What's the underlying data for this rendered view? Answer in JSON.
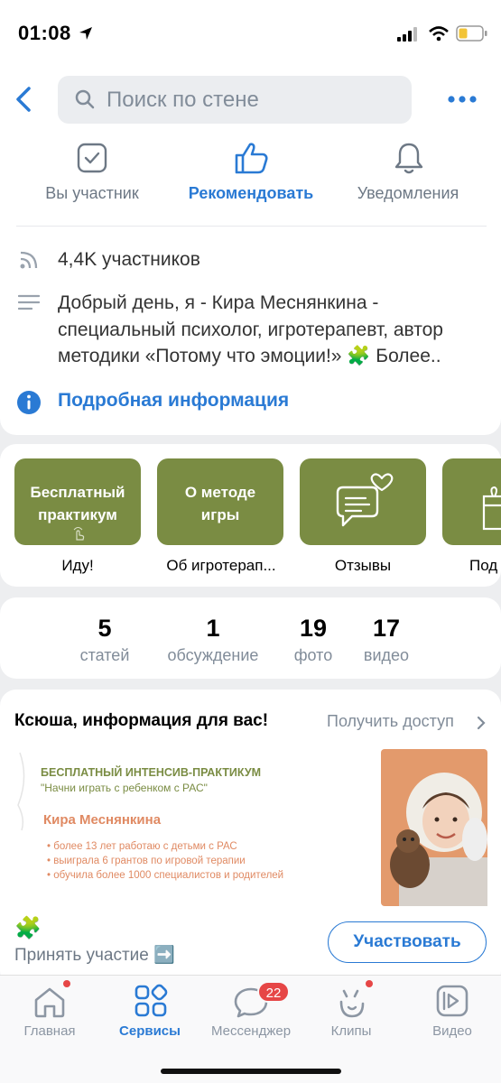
{
  "status_bar": {
    "time": "01:08"
  },
  "header": {
    "search_placeholder": "Поиск по стене"
  },
  "actions": [
    {
      "label": "Вы участник",
      "icon": "checkbox-icon"
    },
    {
      "label": "Рекомендовать",
      "icon": "thumbs-up-icon"
    },
    {
      "label": "Уведомления",
      "icon": "bell-icon"
    }
  ],
  "info": {
    "members": "4,4K участников",
    "description_lines": [
      "Добрый день, я - Кира Меснянкина -",
      "специальный психолог, игротерапевт, автор",
      "методики «Потому что эмоции!» 🧩 Более.."
    ],
    "more_info": "Подробная информация"
  },
  "tiles": [
    {
      "title_lines": [
        "Бесплатный",
        "практикум"
      ],
      "caption": "Иду!"
    },
    {
      "title_lines": [
        "О методе",
        "игры"
      ],
      "caption": "Об игротерап..."
    },
    {
      "caption": "Отзывы",
      "icon": "message-heart-icon"
    },
    {
      "caption": "Под",
      "icon": "gift-icon"
    }
  ],
  "stats": [
    {
      "value": "5",
      "label": "статей"
    },
    {
      "value": "1",
      "label": "обсуждение"
    },
    {
      "value": "19",
      "label": "фото"
    },
    {
      "value": "17",
      "label": "видео"
    }
  ],
  "promo": {
    "title": "Ксюша, информация для вас!",
    "link": "Получить доступ",
    "banner": {
      "heading": "БЕСПЛАТНЫЙ ИНТЕНСИВ-ПРАКТИКУМ",
      "subheading": "\"Начни играть с ребенком с РАС\"",
      "name": "Кира Меснянкина",
      "bullets": [
        "более 13 лет работаю с детьми с РАС",
        "выиграла 6 грантов по игровой терапии",
        "обучила более 1000 специалистов и родителей"
      ]
    },
    "puzzle_emoji": "🧩",
    "cta_text": "Принять участие ➡️",
    "cta_button": "Участвовать"
  },
  "tabbar": [
    {
      "label": "Главная",
      "icon": "home-icon",
      "dot": true
    },
    {
      "label": "Сервисы",
      "icon": "services-icon",
      "active": true
    },
    {
      "label": "Мессенджер",
      "icon": "messenger-icon",
      "badge": "22"
    },
    {
      "label": "Клипы",
      "icon": "clips-icon",
      "dot": true
    },
    {
      "label": "Видео",
      "icon": "video-icon"
    }
  ],
  "colors": {
    "accent": "#2a7ad4",
    "tile": "#7a8c43",
    "banner_orange": "#e08a63"
  }
}
